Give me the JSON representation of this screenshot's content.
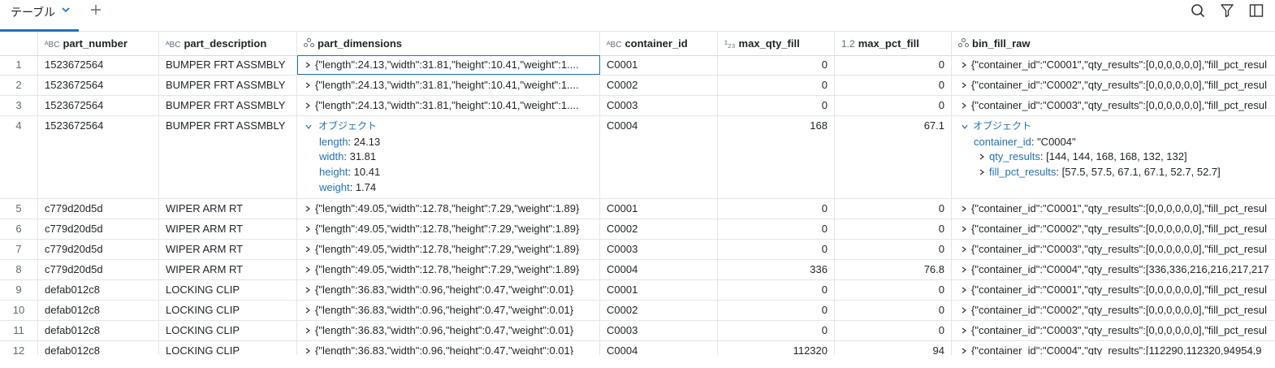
{
  "tab": {
    "label": "テーブル"
  },
  "toolbar": {
    "add_icon": "plus-icon",
    "search_icon": "search-icon",
    "filter_icon": "filter-icon",
    "panel_icon": "sidebar-panel-icon"
  },
  "columns": [
    {
      "type_icon": "ABC",
      "name": "part_number"
    },
    {
      "type_icon": "ABC",
      "name": "part_description"
    },
    {
      "type_icon": "struct",
      "name": "part_dimensions"
    },
    {
      "type_icon": "ABC",
      "name": "container_id"
    },
    {
      "type_icon": "123",
      "name": "max_qty_fill"
    },
    {
      "type_icon": "1.2",
      "name": "max_pct_fill"
    },
    {
      "type_icon": "struct",
      "name": "bin_fill_raw"
    }
  ],
  "rows": [
    {
      "idx": "1",
      "part_number": "1523672564",
      "part_description": "BUMPER FRT ASSMBLY",
      "part_dimensions": "{\"length\":24.13,\"width\":31.81,\"height\":10.41,\"weight\":1....",
      "container_id": "C0001",
      "max_qty_fill": "0",
      "max_pct_fill": "0",
      "bin_fill_raw": "{\"container_id\":\"C0001\",\"qty_results\":[0,0,0,0,0,0],\"fill_pct_resul"
    },
    {
      "idx": "2",
      "part_number": "1523672564",
      "part_description": "BUMPER FRT ASSMBLY",
      "part_dimensions": "{\"length\":24.13,\"width\":31.81,\"height\":10.41,\"weight\":1....",
      "container_id": "C0002",
      "max_qty_fill": "0",
      "max_pct_fill": "0",
      "bin_fill_raw": "{\"container_id\":\"C0002\",\"qty_results\":[0,0,0,0,0,0],\"fill_pct_resul"
    },
    {
      "idx": "3",
      "part_number": "1523672564",
      "part_description": "BUMPER FRT ASSMBLY",
      "part_dimensions": "{\"length\":24.13,\"width\":31.81,\"height\":10.41,\"weight\":1....",
      "container_id": "C0003",
      "max_qty_fill": "0",
      "max_pct_fill": "0",
      "bin_fill_raw": "{\"container_id\":\"C0003\",\"qty_results\":[0,0,0,0,0,0],\"fill_pct_resul"
    },
    {
      "idx": "4",
      "part_number": "1523672564",
      "part_description": "BUMPER FRT ASSMBLY",
      "container_id": "C0004",
      "max_qty_fill": "168",
      "max_pct_fill": "67.1",
      "dims_expanded": {
        "label": "オブジェクト",
        "length_key": "length",
        "length": "24.13",
        "width_key": "width",
        "width": "31.81",
        "height_key": "height",
        "height": "10.41",
        "weight_key": "weight",
        "weight": "1.74"
      },
      "raw_expanded": {
        "label": "オブジェクト",
        "container_key": "container_id",
        "container_val": "\"C0004\"",
        "qty_key": "qty_results",
        "qty_val": "[144, 144, 168, 168, 132, 132]",
        "pct_key": "fill_pct_results",
        "pct_val": "[57.5, 57.5, 67.1, 67.1, 52.7, 52.7]"
      }
    },
    {
      "idx": "5",
      "part_number": "c779d20d5d",
      "part_description": "WIPER ARM RT",
      "part_dimensions": "{\"length\":49.05,\"width\":12.78,\"height\":7.29,\"weight\":1.89}",
      "container_id": "C0001",
      "max_qty_fill": "0",
      "max_pct_fill": "0",
      "bin_fill_raw": "{\"container_id\":\"C0001\",\"qty_results\":[0,0,0,0,0,0],\"fill_pct_resul"
    },
    {
      "idx": "6",
      "part_number": "c779d20d5d",
      "part_description": "WIPER ARM RT",
      "part_dimensions": "{\"length\":49.05,\"width\":12.78,\"height\":7.29,\"weight\":1.89}",
      "container_id": "C0002",
      "max_qty_fill": "0",
      "max_pct_fill": "0",
      "bin_fill_raw": "{\"container_id\":\"C0002\",\"qty_results\":[0,0,0,0,0,0],\"fill_pct_resul"
    },
    {
      "idx": "7",
      "part_number": "c779d20d5d",
      "part_description": "WIPER ARM RT",
      "part_dimensions": "{\"length\":49.05,\"width\":12.78,\"height\":7.29,\"weight\":1.89}",
      "container_id": "C0003",
      "max_qty_fill": "0",
      "max_pct_fill": "0",
      "bin_fill_raw": "{\"container_id\":\"C0003\",\"qty_results\":[0,0,0,0,0,0],\"fill_pct_resul"
    },
    {
      "idx": "8",
      "part_number": "c779d20d5d",
      "part_description": "WIPER ARM RT",
      "part_dimensions": "{\"length\":49.05,\"width\":12.78,\"height\":7.29,\"weight\":1.89}",
      "container_id": "C0004",
      "max_qty_fill": "336",
      "max_pct_fill": "76.8",
      "bin_fill_raw": "{\"container_id\":\"C0004\",\"qty_results\":[336,336,216,216,217,217"
    },
    {
      "idx": "9",
      "part_number": "defab012c8",
      "part_description": "LOCKING CLIP",
      "part_dimensions": "{\"length\":36.83,\"width\":0.96,\"height\":0.47,\"weight\":0.01}",
      "container_id": "C0001",
      "max_qty_fill": "0",
      "max_pct_fill": "0",
      "bin_fill_raw": "{\"container_id\":\"C0001\",\"qty_results\":[0,0,0,0,0,0],\"fill_pct_resul"
    },
    {
      "idx": "10",
      "part_number": "defab012c8",
      "part_description": "LOCKING CLIP",
      "part_dimensions": "{\"length\":36.83,\"width\":0.96,\"height\":0.47,\"weight\":0.01}",
      "container_id": "C0002",
      "max_qty_fill": "0",
      "max_pct_fill": "0",
      "bin_fill_raw": "{\"container_id\":\"C0002\",\"qty_results\":[0,0,0,0,0,0],\"fill_pct_resul"
    },
    {
      "idx": "11",
      "part_number": "defab012c8",
      "part_description": "LOCKING CLIP",
      "part_dimensions": "{\"length\":36.83,\"width\":0.96,\"height\":0.47,\"weight\":0.01}",
      "container_id": "C0003",
      "max_qty_fill": "0",
      "max_pct_fill": "0",
      "bin_fill_raw": "{\"container_id\":\"C0003\",\"qty_results\":[0,0,0,0,0,0],\"fill_pct_resul"
    },
    {
      "idx": "12",
      "part_number": "defab012c8",
      "part_description": "LOCKING CLIP",
      "part_dimensions": "{\"length\":36.83,\"width\":0.96,\"height\":0.47,\"weight\":0.01}",
      "container_id": "C0004",
      "max_qty_fill": "112320",
      "max_pct_fill": "94",
      "bin_fill_raw": "{\"container_id\":\"C0004\",\"qty_results\":[112290,112320,94954,9"
    }
  ],
  "colors": {
    "accent": "#2272b4",
    "border": "#e3e5e8"
  }
}
